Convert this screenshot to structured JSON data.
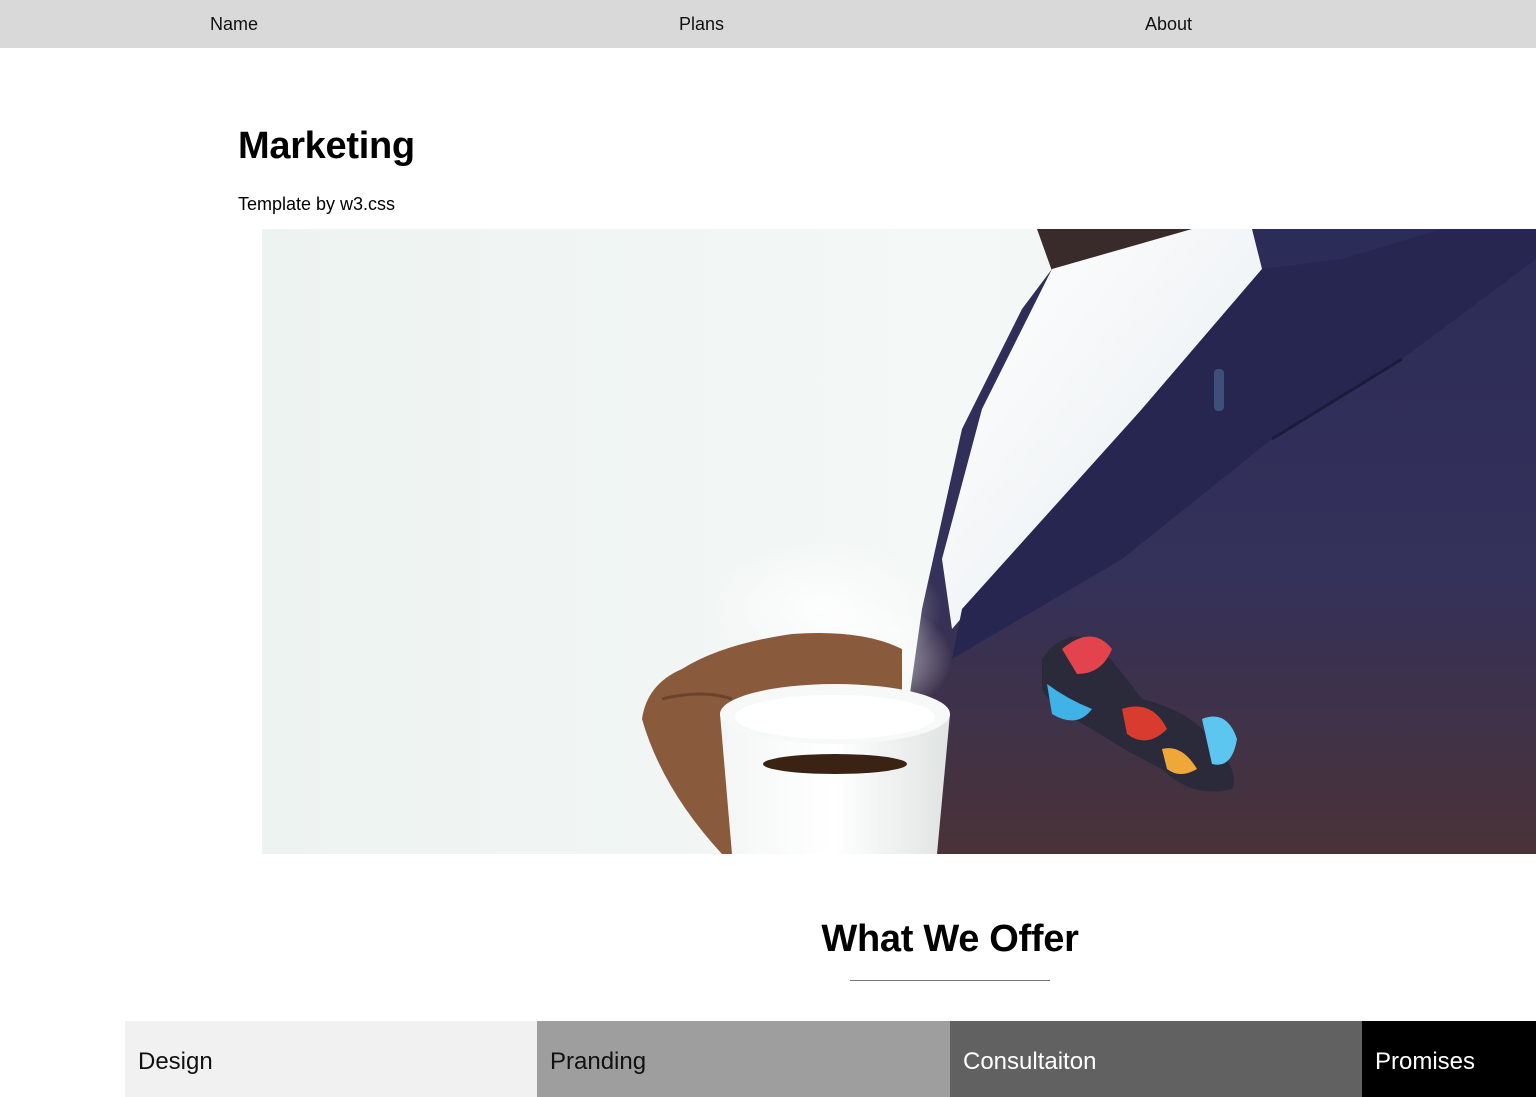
{
  "nav": {
    "items": [
      {
        "label": "Name"
      },
      {
        "label": "Plans"
      },
      {
        "label": "About"
      }
    ]
  },
  "header": {
    "title": "Marketing",
    "subtitle": "Template by w3.css"
  },
  "hero": {
    "image": "man-in-suit-holding-coffee-cup"
  },
  "offer_section": {
    "title": "What We Offer",
    "items": [
      {
        "label": "Design",
        "color": "#f1f1f1"
      },
      {
        "label": "Pranding",
        "color": "#9e9e9e"
      },
      {
        "label": "Consultaiton",
        "color": "#616161"
      },
      {
        "label": "Promises",
        "color": "#000000"
      }
    ]
  }
}
